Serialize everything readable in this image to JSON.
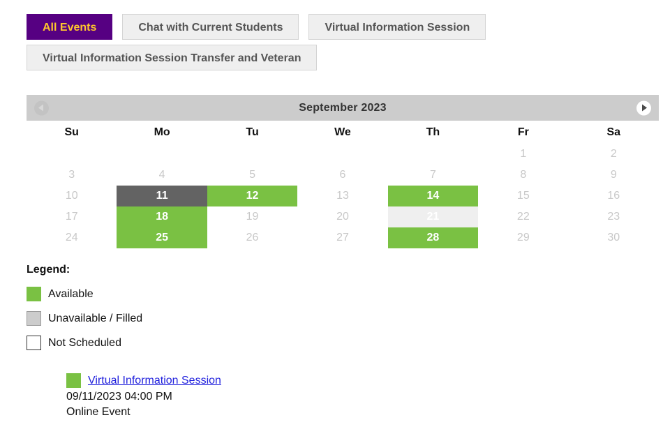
{
  "tabs": [
    {
      "label": "All Events",
      "active": true
    },
    {
      "label": "Chat with Current Students",
      "active": false
    },
    {
      "label": "Virtual Information Session",
      "active": false
    },
    {
      "label": "Virtual Information Session Transfer and Veteran",
      "active": false
    }
  ],
  "calendar": {
    "title": "September 2023",
    "prev_icon": "chevron-left-icon",
    "next_icon": "chevron-right-icon",
    "weekdays": [
      "Su",
      "Mo",
      "Tu",
      "We",
      "Th",
      "Fr",
      "Sa"
    ],
    "weeks": [
      [
        {
          "day": "",
          "state": "empty"
        },
        {
          "day": "",
          "state": "empty"
        },
        {
          "day": "",
          "state": "empty"
        },
        {
          "day": "",
          "state": "empty"
        },
        {
          "day": "",
          "state": "empty"
        },
        {
          "day": "1",
          "state": "none"
        },
        {
          "day": "2",
          "state": "none"
        }
      ],
      [
        {
          "day": "3",
          "state": "none"
        },
        {
          "day": "4",
          "state": "none"
        },
        {
          "day": "5",
          "state": "none"
        },
        {
          "day": "6",
          "state": "none"
        },
        {
          "day": "7",
          "state": "none"
        },
        {
          "day": "8",
          "state": "none"
        },
        {
          "day": "9",
          "state": "none"
        }
      ],
      [
        {
          "day": "10",
          "state": "none"
        },
        {
          "day": "11",
          "state": "today"
        },
        {
          "day": "12",
          "state": "avail"
        },
        {
          "day": "13",
          "state": "none"
        },
        {
          "day": "14",
          "state": "avail"
        },
        {
          "day": "15",
          "state": "none"
        },
        {
          "day": "16",
          "state": "none"
        }
      ],
      [
        {
          "day": "17",
          "state": "none"
        },
        {
          "day": "18",
          "state": "avail"
        },
        {
          "day": "19",
          "state": "none"
        },
        {
          "day": "20",
          "state": "none"
        },
        {
          "day": "21",
          "state": "unavail"
        },
        {
          "day": "22",
          "state": "none"
        },
        {
          "day": "23",
          "state": "none"
        }
      ],
      [
        {
          "day": "24",
          "state": "none"
        },
        {
          "day": "25",
          "state": "avail"
        },
        {
          "day": "26",
          "state": "none"
        },
        {
          "day": "27",
          "state": "none"
        },
        {
          "day": "28",
          "state": "avail"
        },
        {
          "day": "29",
          "state": "none"
        },
        {
          "day": "30",
          "state": "none"
        }
      ]
    ]
  },
  "legend": {
    "title": "Legend:",
    "items": [
      {
        "label": "Available",
        "swatch": "sw-avail"
      },
      {
        "label": "Unavailable / Filled",
        "swatch": "sw-unavail"
      },
      {
        "label": "Not Scheduled",
        "swatch": "sw-none"
      }
    ]
  },
  "event": {
    "title": "Virtual Information Session",
    "datetime": "09/11/2023 04:00 PM",
    "location": "Online Event"
  },
  "colors": {
    "accent_purple": "#560082",
    "accent_gold": "#ffc72c",
    "available_green": "#7ac143",
    "today_gray": "#636363",
    "unavailable_gray": "#efefef",
    "header_gray": "#cccccc",
    "link_blue": "#2222dd"
  }
}
